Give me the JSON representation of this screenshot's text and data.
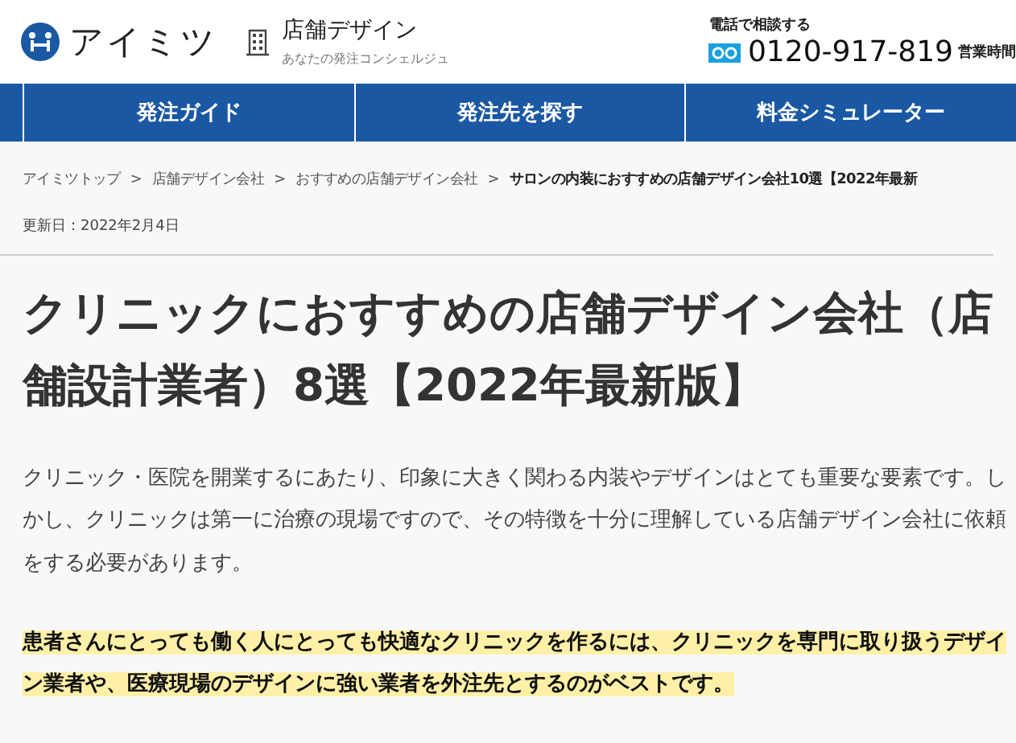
{
  "header": {
    "logo": "アイミツ",
    "category": "店舗デザイン",
    "tagline": "あなたの発注コンシェルジュ",
    "phone_label": "電話で相談する",
    "phone": "0120-917-819",
    "hours_label": "営業時間"
  },
  "nav": [
    {
      "label": "発注ガイド"
    },
    {
      "label": "発注先を探す"
    },
    {
      "label": "料金シミュレーター"
    }
  ],
  "breadcrumbs": {
    "separator": ">",
    "items": [
      {
        "label": "アイミツトップ",
        "current": false
      },
      {
        "label": "店舗デザイン会社",
        "current": false
      },
      {
        "label": "おすすめの店舗デザイン会社",
        "current": false
      },
      {
        "label": "サロンの内装におすすめの店舗デザイン会社10選【2022年最新",
        "current": true
      }
    ]
  },
  "updated": "更新日：2022年2月4日",
  "title": "クリニックにおすすめの店舗デザイン会社（店舗設計業者）8選【2022年最新版】",
  "intro": "クリニック・医院を開業するにあたり、印象に大きく関わる内装やデザインはとても重要な要素です。しかし、クリニックは第一に治療の現場ですので、その特徴を十分に理解している店舗デザイン会社に依頼をする必要があります。",
  "highlight": "患者さんにとっても働く人にとっても快適なクリニックを作るには、クリニックを専門に取り扱うデザイン業者や、医療現場のデザインに強い業者を外注先とするのがベストです。"
}
